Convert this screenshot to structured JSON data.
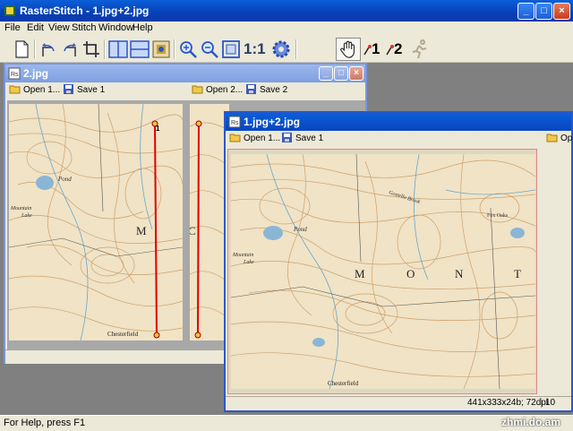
{
  "main_window": {
    "title": "RasterStitch - 1.jpg+2.jpg",
    "buttons": {
      "minimize": "_",
      "maximize": "□",
      "close": "×"
    }
  },
  "menu": [
    "File",
    "Edit",
    "View",
    "Stitch",
    "Window",
    "Help"
  ],
  "toolbar": {
    "icons": [
      "new-document-icon",
      "rotate-left-icon",
      "rotate-right-icon",
      "crop-icon",
      "side-by-side-icon",
      "stacked-icon",
      "stitch-icon",
      "zoom-in-icon",
      "zoom-out-icon",
      "fit-window-icon",
      "actual-size-icon",
      "settings-gear-icon",
      "hand-pan-icon",
      "point-1-icon",
      "point-2-icon",
      "auto-stitch-icon"
    ],
    "actual_size_label": "1:1",
    "point1_label": "1",
    "point2_label": "2"
  },
  "window_2": {
    "title": "2.jpg",
    "left_pane": {
      "open_label": "Open 1...",
      "save_label": "Save 1"
    },
    "right_pane": {
      "open_label": "Open 2...",
      "save_label": "Save 2"
    }
  },
  "window_1": {
    "title": "1.jpg+2.jpg",
    "open_label": "Open 1...",
    "save_label": "Save 1",
    "right_open_label": "Op",
    "status_info": "441x333x24b; 72dpi",
    "status_zoom": "10"
  },
  "map_labels": {
    "m": "M",
    "o": "O",
    "n": "N",
    "t": "T",
    "c": "C",
    "pond": "Pond",
    "lake": "Lake",
    "mountain": "Mountain",
    "chesterfield": "Chesterfield",
    "gostello": "Gostello Brook",
    "fox_oaks": "Fox Oaks"
  },
  "status_bar": {
    "text": "For Help, press F1"
  },
  "watermark": "zhmi.do.am"
}
